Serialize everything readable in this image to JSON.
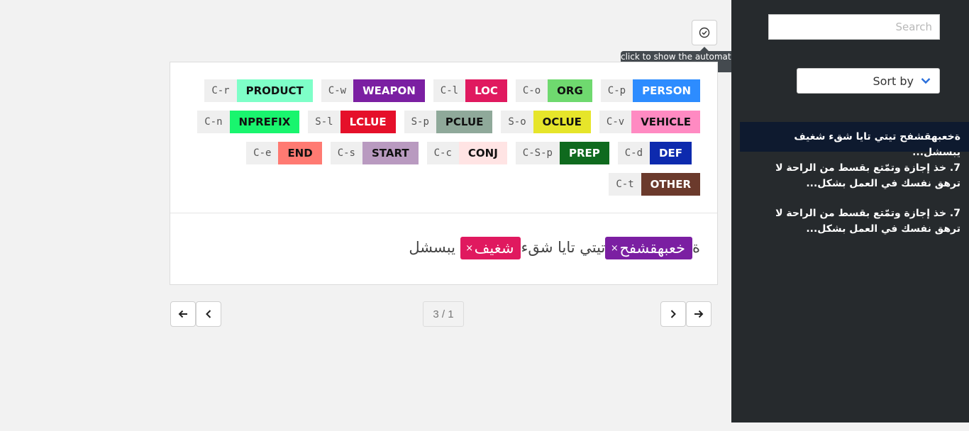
{
  "toolbar": {
    "auto_icon": "check-circle-icon",
    "tooltip": "click to show the automatic annotations"
  },
  "labels": [
    {
      "shortcut": "C-r",
      "name": "PRODUCT",
      "bg": "#7effc8",
      "fg": "#111111"
    },
    {
      "shortcut": "C-w",
      "name": "WEAPON",
      "bg": "#7b1fa2",
      "fg": "#ffffff"
    },
    {
      "shortcut": "C-l",
      "name": "LOC",
      "bg": "#e0195f",
      "fg": "#ffffff"
    },
    {
      "shortcut": "C-o",
      "name": "ORG",
      "bg": "#6fd96f",
      "fg": "#111111"
    },
    {
      "shortcut": "C-p",
      "name": "PERSON",
      "bg": "#2d8cff",
      "fg": "#ffffff"
    },
    {
      "shortcut": "C-n",
      "name": "NPREFIX",
      "bg": "#19f56e",
      "fg": "#111111"
    },
    {
      "shortcut": "S-l",
      "name": "LCLUE",
      "bg": "#e5102a",
      "fg": "#ffffff"
    },
    {
      "shortcut": "S-p",
      "name": "PCLUE",
      "bg": "#8fa99a",
      "fg": "#111111"
    },
    {
      "shortcut": "S-o",
      "name": "OCLUE",
      "bg": "#e6e52a",
      "fg": "#111111"
    },
    {
      "shortcut": "C-v",
      "name": "VEHICLE",
      "bg": "#ff8ac2",
      "fg": "#111111"
    },
    {
      "shortcut": "C-e",
      "name": "END",
      "bg": "#ff7a72",
      "fg": "#111111"
    },
    {
      "shortcut": "C-s",
      "name": "START",
      "bg": "#b99ac0",
      "fg": "#111111"
    },
    {
      "shortcut": "C-c",
      "name": "CONJ",
      "bg": "#ffe4e4",
      "fg": "#111111"
    },
    {
      "shortcut": "C-S-p",
      "name": "PREP",
      "bg": "#0f6a1e",
      "fg": "#ffffff"
    },
    {
      "shortcut": "C-d",
      "name": "DEF",
      "bg": "#0d2aae",
      "fg": "#ffffff"
    },
    {
      "shortcut": "C-t",
      "name": "OTHER",
      "bg": "#6b3a2c",
      "fg": "#ffffff"
    }
  ],
  "document": {
    "prefix": "ة",
    "entity1": {
      "text": "خعبهقشفح",
      "label": "WEAPON",
      "color": "#7b1fa2"
    },
    "middle": "تيتي تايا شقء",
    "entity2": {
      "text": "شغيف",
      "label": "LOC",
      "color": "#e0195f"
    },
    "suffix": "يبسشل",
    "remove_mark": "×"
  },
  "pager": {
    "text": "3 / 1"
  },
  "sidebar": {
    "search_placeholder": "Search",
    "sort_label": "Sort by",
    "docs": [
      {
        "text": "ةخعبهقشفح تيتي تايا شقء شغيف يبسشل..."
      },
      {
        "text": "7. خذ إجازة وتمّتع بقسط من الراحة لا ترهق نفسك في العمل بشكل..."
      },
      {
        "text": "7. خذ إجازة وتمّتع بقسط من الراحة لا ترهق نفسك في العمل بشكل..."
      }
    ]
  },
  "colors": {
    "sidebar_bg": "#262a2d",
    "active_doc_bg": "#0e1a2f",
    "accent": "#2a6fdb"
  }
}
